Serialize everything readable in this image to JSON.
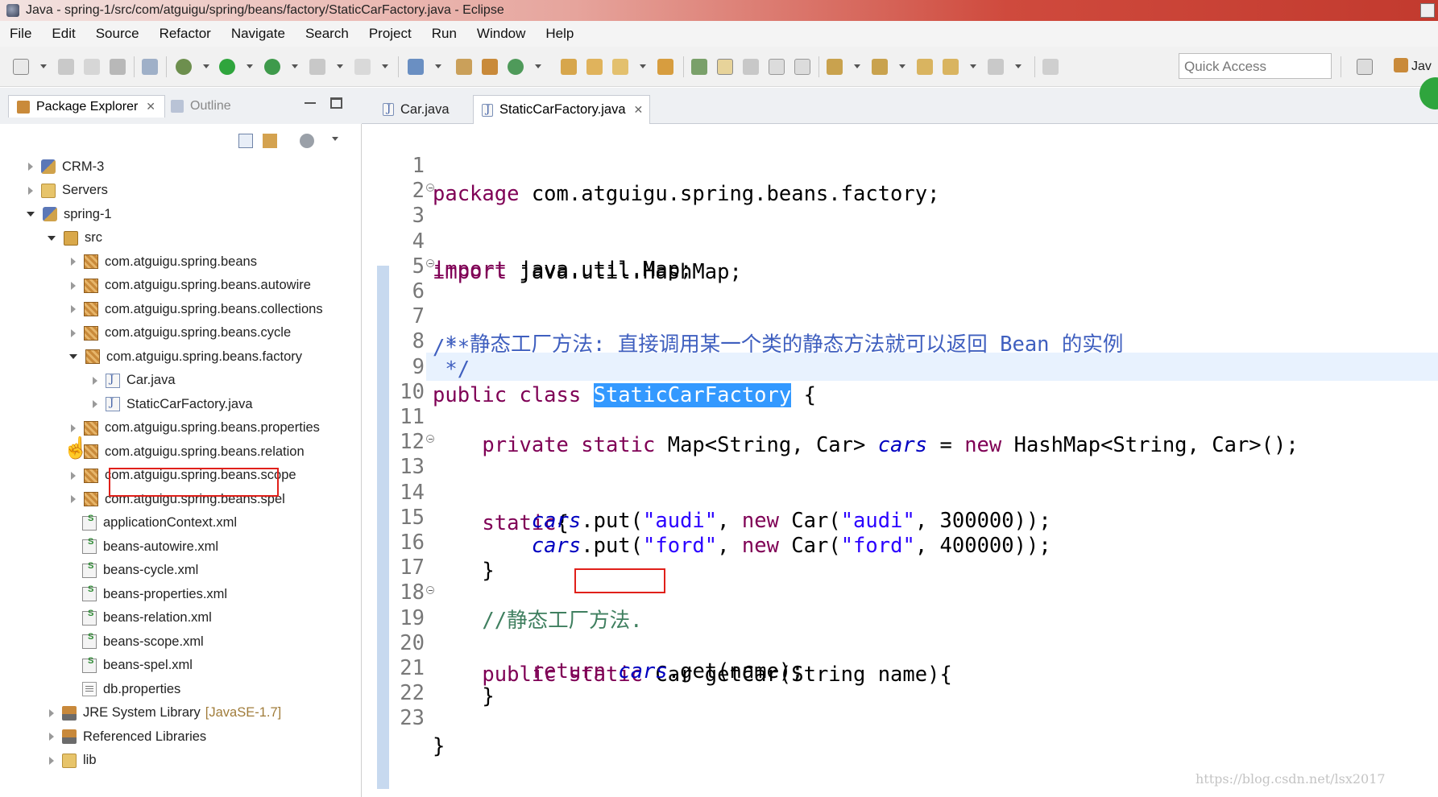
{
  "window": {
    "title": "Java - spring-1/src/com/atguigu/spring/beans/factory/StaticCarFactory.java - Eclipse"
  },
  "menu": [
    "File",
    "Edit",
    "Source",
    "Refactor",
    "Navigate",
    "Search",
    "Project",
    "Run",
    "Window",
    "Help"
  ],
  "toolbar": {
    "quick_access_placeholder": "Quick Access",
    "perspective_label": "Jav"
  },
  "left_panel": {
    "tabs": {
      "package_explorer": "Package Explorer",
      "outline": "Outline"
    },
    "tree": [
      {
        "label": "CRM-3",
        "icon": "project-icon",
        "state": "collapsed"
      },
      {
        "label": "Servers",
        "icon": "folder-icon",
        "state": "collapsed"
      },
      {
        "label": "spring-1",
        "icon": "project-icon",
        "state": "expanded"
      },
      {
        "label": "src",
        "icon": "source-folder-icon",
        "state": "expanded"
      },
      {
        "label": "com.atguigu.spring.beans",
        "icon": "package-icon",
        "state": "collapsed"
      },
      {
        "label": "com.atguigu.spring.beans.autowire",
        "icon": "package-icon",
        "state": "collapsed"
      },
      {
        "label": "com.atguigu.spring.beans.collections",
        "icon": "package-icon",
        "state": "collapsed"
      },
      {
        "label": "com.atguigu.spring.beans.cycle",
        "icon": "package-icon",
        "state": "collapsed"
      },
      {
        "label": "com.atguigu.spring.beans.factory",
        "icon": "package-icon",
        "state": "expanded"
      },
      {
        "label": "Car.java",
        "icon": "java-file-icon",
        "state": "collapsed"
      },
      {
        "label": "StaticCarFactory.java",
        "icon": "java-file-icon",
        "state": "collapsed"
      },
      {
        "label": "com.atguigu.spring.beans.properties",
        "icon": "package-icon",
        "state": "collapsed"
      },
      {
        "label": "com.atguigu.spring.beans.relation",
        "icon": "package-icon",
        "state": "collapsed"
      },
      {
        "label": "com.atguigu.spring.beans.scope",
        "icon": "package-icon",
        "state": "collapsed"
      },
      {
        "label": "com.atguigu.spring.beans.spel",
        "icon": "package-icon",
        "state": "collapsed"
      },
      {
        "label": "applicationContext.xml",
        "icon": "spring-xml-icon",
        "state": "none"
      },
      {
        "label": "beans-autowire.xml",
        "icon": "spring-xml-icon",
        "state": "none"
      },
      {
        "label": "beans-cycle.xml",
        "icon": "spring-xml-icon",
        "state": "none"
      },
      {
        "label": "beans-properties.xml",
        "icon": "spring-xml-icon",
        "state": "none"
      },
      {
        "label": "beans-relation.xml",
        "icon": "spring-xml-icon",
        "state": "none"
      },
      {
        "label": "beans-scope.xml",
        "icon": "spring-xml-icon",
        "state": "none"
      },
      {
        "label": "beans-spel.xml",
        "icon": "spring-xml-icon",
        "state": "none"
      },
      {
        "label": "db.properties",
        "icon": "properties-file-icon",
        "state": "none"
      },
      {
        "label": "JRE System Library",
        "decoration": "[JavaSE-1.7]",
        "icon": "library-icon",
        "state": "collapsed"
      },
      {
        "label": "Referenced Libraries",
        "icon": "library-icon",
        "state": "collapsed"
      },
      {
        "label": "lib",
        "icon": "folder-icon",
        "state": "collapsed"
      }
    ]
  },
  "editor": {
    "tabs": {
      "car": "Car.java",
      "factory": "StaticCarFactory.java"
    },
    "lines": [
      "1",
      "2",
      "3",
      "4",
      "5",
      "6",
      "7",
      "8",
      "9",
      "10",
      "11",
      "12",
      "13",
      "14",
      "15",
      "16",
      "17",
      "18",
      "19",
      "20",
      "21",
      "22",
      "23"
    ],
    "code": {
      "l1_kw": "package",
      "l1_rest": " com.atguigu.spring.beans.factory;",
      "l3_kw": "import",
      "l3_rest": " java.util.HashMap;",
      "l4_kw": "import",
      "l4_rest": " java.util.Map;",
      "l6": "/**",
      "l7": " * 静态工厂方法: 直接调用某一个类的静态方法就可以返回 Bean 的实例",
      "l8": " */",
      "l9_kw": "public class ",
      "l9_sel": "StaticCarFactory",
      "l9_rest": " {",
      "l11_indent": "    ",
      "l11_kw": "private static",
      "l11_a": " Map<String, Car> ",
      "l11_fld": "cars",
      "l11_b": " = ",
      "l11_kw2": "new",
      "l11_c": " HashMap<String, Car>();",
      "l13_indent": "    ",
      "l13_kw": "static",
      "l13_rest": "{",
      "l14_indent": "        ",
      "l14_fld": "cars",
      "l14_a": ".put(",
      "l14_s1": "\"audi\"",
      "l14_b": ", ",
      "l14_kw": "new",
      "l14_c": " Car(",
      "l14_s2": "\"audi\"",
      "l14_d": ", 300000));",
      "l15_indent": "        ",
      "l15_fld": "cars",
      "l15_a": ".put(",
      "l15_s1": "\"ford\"",
      "l15_b": ", ",
      "l15_kw": "new",
      "l15_c": " Car(",
      "l15_s2": "\"ford\"",
      "l15_d": ", 400000));",
      "l16": "    }",
      "l18": "    //静态工厂方法.",
      "l19_indent": "    ",
      "l19_kw": "public static",
      "l19_rest": " Car getCar(String name){",
      "l20_indent": "        ",
      "l20_kw": "return",
      "l20_sp": " ",
      "l20_fld": "cars",
      "l20_rest": ".get(name);",
      "l21": "    }",
      "l23": "}"
    }
  },
  "watermark": "https://blog.csdn.net/lsx2017"
}
